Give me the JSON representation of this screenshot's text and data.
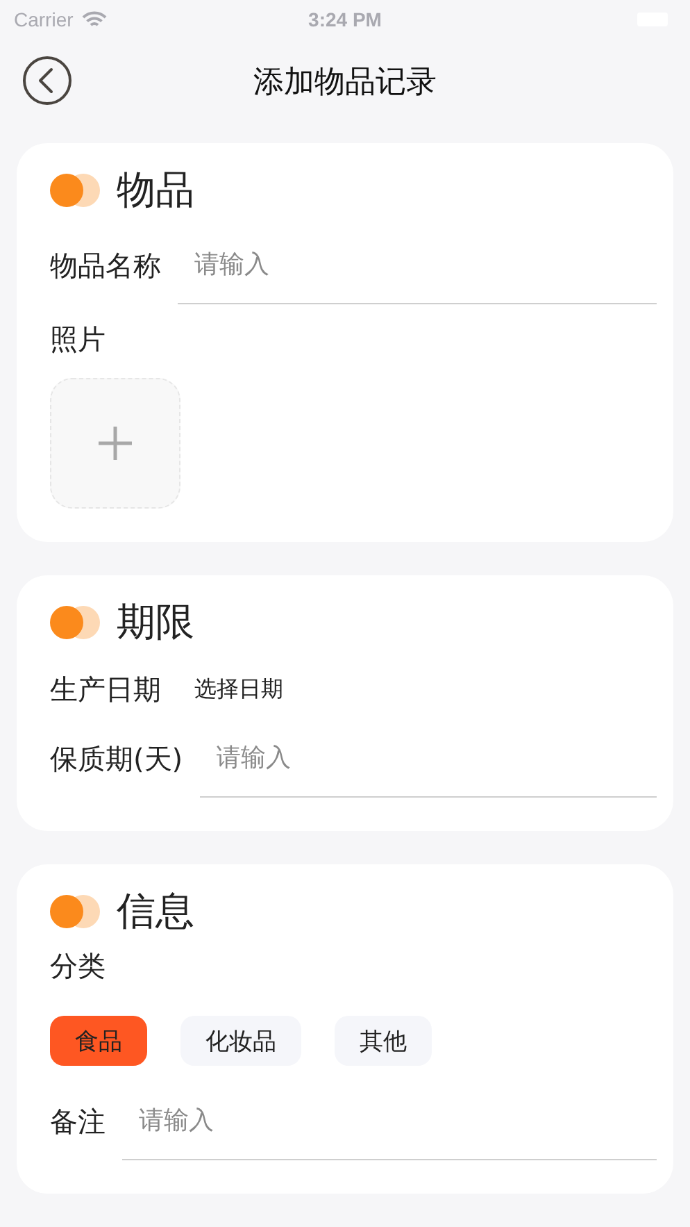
{
  "status_bar": {
    "carrier": "Carrier",
    "time": "3:24 PM"
  },
  "nav": {
    "title": "添加物品记录"
  },
  "sections": [
    {
      "title": "物品",
      "fields": [
        {
          "kind": "text",
          "label": "物品名称",
          "placeholder": "请输入"
        },
        {
          "kind": "photo",
          "label": "照片"
        }
      ]
    },
    {
      "title": "期限",
      "fields": [
        {
          "kind": "date",
          "label": "生产日期",
          "value": "选择日期"
        },
        {
          "kind": "text",
          "label": "保质期(天)",
          "placeholder": "请输入"
        }
      ]
    },
    {
      "title": "信息",
      "fields": [
        {
          "kind": "chips",
          "label": "分类",
          "options": [
            {
              "label": "食品",
              "selected": true
            },
            {
              "label": "化妆品",
              "selected": false
            },
            {
              "label": "其他",
              "selected": false
            }
          ]
        },
        {
          "kind": "text",
          "label": "备注",
          "placeholder": "请输入"
        }
      ]
    }
  ]
}
